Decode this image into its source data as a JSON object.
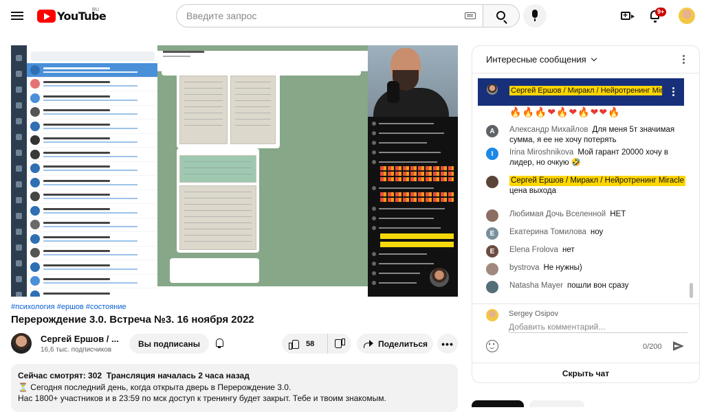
{
  "header": {
    "logo_text": "YouTube",
    "logo_region": "RU",
    "search_placeholder": "Введите запрос",
    "notifications_badge": "9+"
  },
  "video": {
    "hashtags": [
      "#психология",
      "#ершов",
      "#состояние"
    ],
    "title": "Перерождение 3.0. Встреча №3. 16 ноября 2022",
    "channel_name": "Сергей Ершов / ...",
    "subscribers": "16,6 тыс. подписчиков",
    "subscribed_label": "Вы подписаны",
    "like_count": "58",
    "share_label": "Поделиться",
    "more_label": "•••"
  },
  "description": {
    "watching_now": "Сейчас смотрят: 302",
    "started": "Трансляция началась 2 часа назад",
    "line1": "⏳ Сегодня последний день, когда открыта дверь в Перерождение 3.0.",
    "line2": "Нас 1800+ участников и в 23:59 по мск доступ к тренингу будет закрыт. Тебе и твоим знакомым."
  },
  "chat": {
    "header_title": "Интересные сообщения",
    "pinned_author": "Сергей Ершов / Миракл / Нейротренинг Miracle",
    "emoji_line": [
      "fire",
      "fire",
      "fire",
      "heart",
      "fire",
      "heart",
      "fire",
      "heart",
      "heart",
      "fire"
    ],
    "messages": [
      {
        "author": "Александр Михайлов",
        "text": "Для меня 5т значимая сумма, я ее не хочу потерять",
        "avatar_letter": "A",
        "avatar_color": "#5f6368",
        "highlight": false
      },
      {
        "author": "Irina Miroshnikova",
        "text": "Мой гарант 20000 хочу в лидер, но очкую 🤣",
        "avatar_letter": "I",
        "avatar_color": "#1e88e5",
        "highlight": false
      },
      {
        "author": "Сергей Ершов / Миракл / Нейротренинг Miracle",
        "text": "цена выхода",
        "avatar_letter": "",
        "avatar_color": "#5a4438",
        "highlight": true
      },
      {
        "author": "Любимая Дочь Вселенной",
        "text": "НЕТ",
        "avatar_letter": "",
        "avatar_color": "#8d6e63",
        "highlight": false
      },
      {
        "author": "Екатерина Томилова",
        "text": "ноу",
        "avatar_letter": "E",
        "avatar_color": "#78909c",
        "highlight": false
      },
      {
        "author": "Elena Frolova",
        "text": "нет",
        "avatar_letter": "E",
        "avatar_color": "#6d4c41",
        "highlight": false
      },
      {
        "author": "bystrova",
        "text": "Не нужны)",
        "avatar_letter": "",
        "avatar_color": "#a1887f",
        "highlight": false
      },
      {
        "author": "Natasha Mayer",
        "text": "пошли вон сразу",
        "avatar_letter": "",
        "avatar_color": "#546e7a",
        "highlight": false
      }
    ],
    "me_name": "Sergey Osipov",
    "input_placeholder": "Добавить комментарий...",
    "counter": "0/200",
    "hide_chat_label": "Скрыть чат"
  }
}
